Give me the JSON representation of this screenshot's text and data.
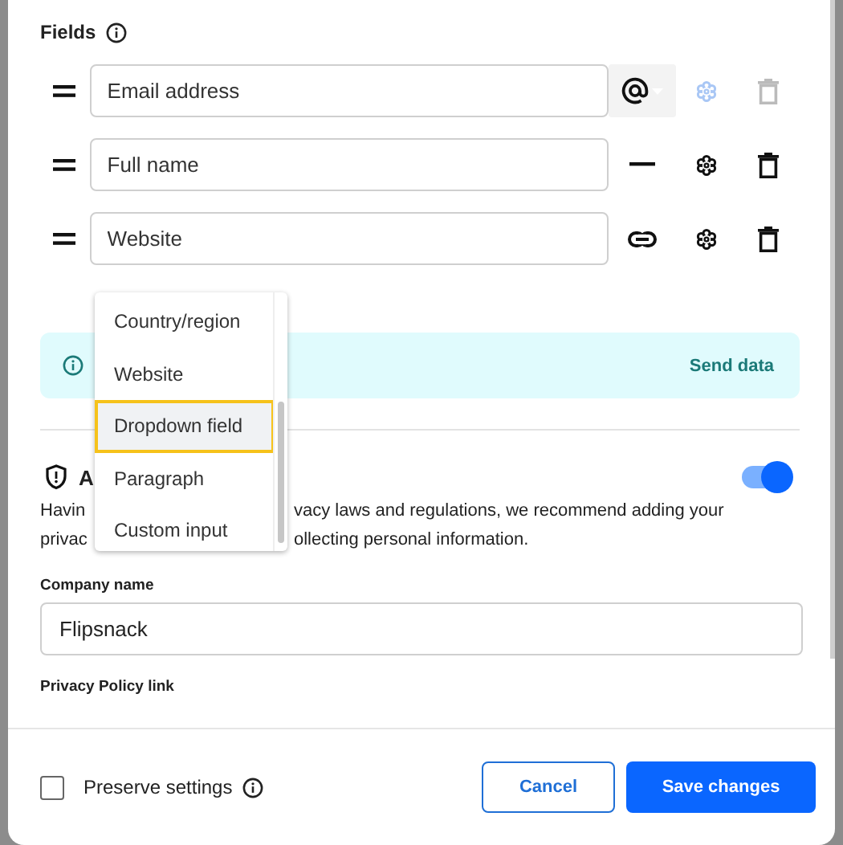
{
  "fields_heading": "Fields",
  "fields": [
    {
      "value": "Email address",
      "kind": "email",
      "disabled": true
    },
    {
      "value": "Full name",
      "kind": "text",
      "disabled": false
    },
    {
      "value": "Website",
      "kind": "link",
      "disabled": false
    }
  ],
  "banner": {
    "action": "Send data"
  },
  "privacy": {
    "title_fragment": "A",
    "on": true,
    "text_fragments": [
      [
        "Havin",
        "vacy laws and regulations, we recommend adding your"
      ],
      [
        "privac",
        "ollecting personal information."
      ]
    ]
  },
  "company": {
    "label": "Company name",
    "value": "Flipsnack"
  },
  "privacy_link": {
    "label": "Privacy Policy link"
  },
  "menu": [
    {
      "label": "Country/region",
      "selected": false
    },
    {
      "label": "Website",
      "selected": false
    },
    {
      "label": "Dropdown field",
      "selected": true
    },
    {
      "label": "Paragraph",
      "selected": false
    },
    {
      "label": "Custom input",
      "selected": false
    }
  ],
  "footer": {
    "preserve": {
      "label": "Preserve settings",
      "checked": false
    },
    "cancel": "Cancel",
    "save": "Save changes"
  }
}
